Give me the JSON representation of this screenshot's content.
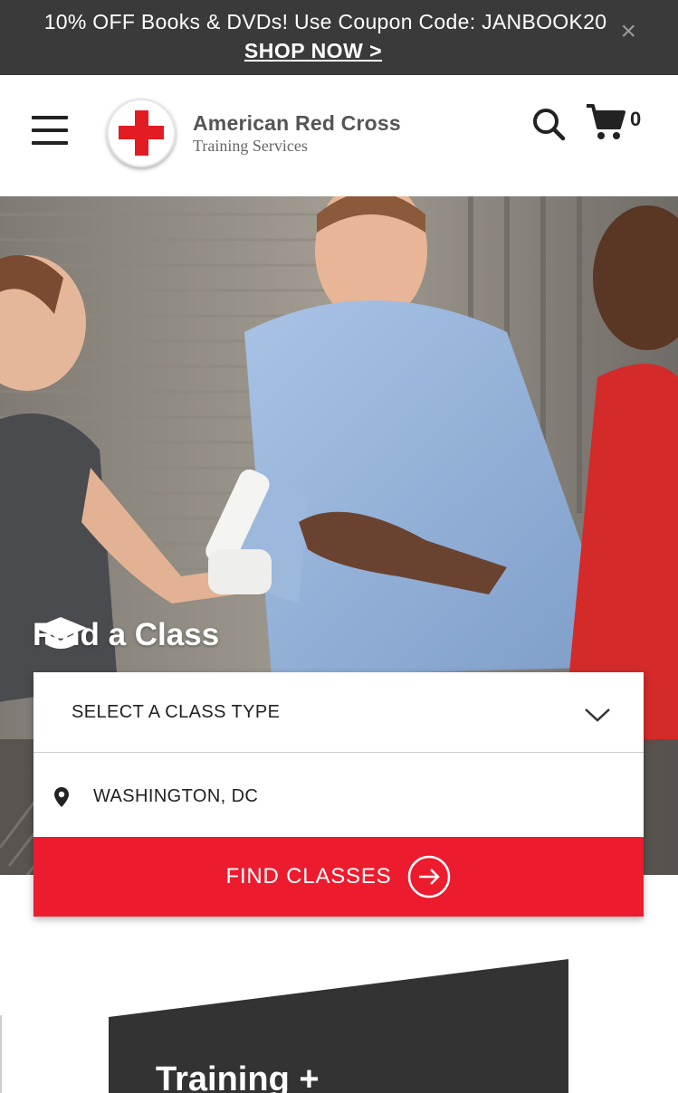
{
  "promo_banner": {
    "text": "10% OFF Books & DVDs! Use Coupon Code: JANBOOK20",
    "link": "SHOP NOW >",
    "close_label": "×"
  },
  "header": {
    "logo_title": "American Red Cross",
    "logo_subtitle": "Training Services",
    "cart_count": "0"
  },
  "hero": {
    "find_title": "Find a Class"
  },
  "form": {
    "class_type_label": "SELECT A CLASS TYPE",
    "location_value": "WASHINGTON, DC",
    "submit_label": "FIND CLASSES"
  },
  "feature": {
    "title": "Training +"
  },
  "colors": {
    "brand_red": "#ed1b2e",
    "banner_dark": "#3a3a3a",
    "card_dark": "#333333"
  }
}
